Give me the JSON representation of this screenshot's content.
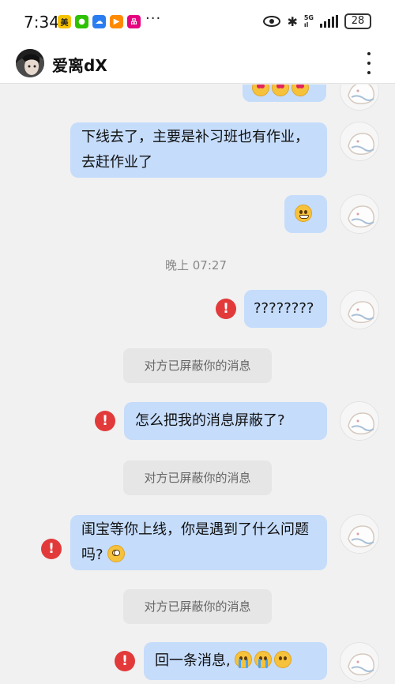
{
  "status_bar": {
    "time": "7:34",
    "app_icons": [
      {
        "name": "meituan-icon",
        "glyph": "美",
        "color": "#f5c200"
      },
      {
        "name": "wechat-icon",
        "glyph": "●",
        "color": "#2dc100"
      },
      {
        "name": "cloud-icon",
        "glyph": "☁",
        "color": "#2a7df0"
      },
      {
        "name": "video-icon",
        "glyph": "▶",
        "color": "#ff8a00"
      },
      {
        "name": "vipshop-icon",
        "glyph": "品",
        "color": "#e5007f"
      }
    ],
    "more": "···",
    "network": "5G",
    "battery": "28"
  },
  "header": {
    "title": "爱离dX"
  },
  "messages": {
    "m1_emojis": [
      "kiss-emoji",
      "heart-eyes-emoji",
      "heart-eyes-emoji"
    ],
    "m2_text": "下线去了，主要是补习班也有作业，去赶作业了",
    "m3_emoji": "grinning-emoji",
    "time_label": "晚上 07:27",
    "m4_text": "????????",
    "blocked_notice_1": "对方已屏蔽你的消息",
    "m5_text": "怎么把我的消息屏蔽了?",
    "blocked_notice_2": "对方已屏蔽你的消息",
    "m6_text": "闺宝等你上线，你是遇到了什么问题吗?",
    "blocked_notice_3": "对方已屏蔽你的消息",
    "m7_text": "回一条消息,"
  },
  "colors": {
    "bubble": "#c5dcfb",
    "error": "#e23a3a",
    "background": "#f1f1f1"
  }
}
